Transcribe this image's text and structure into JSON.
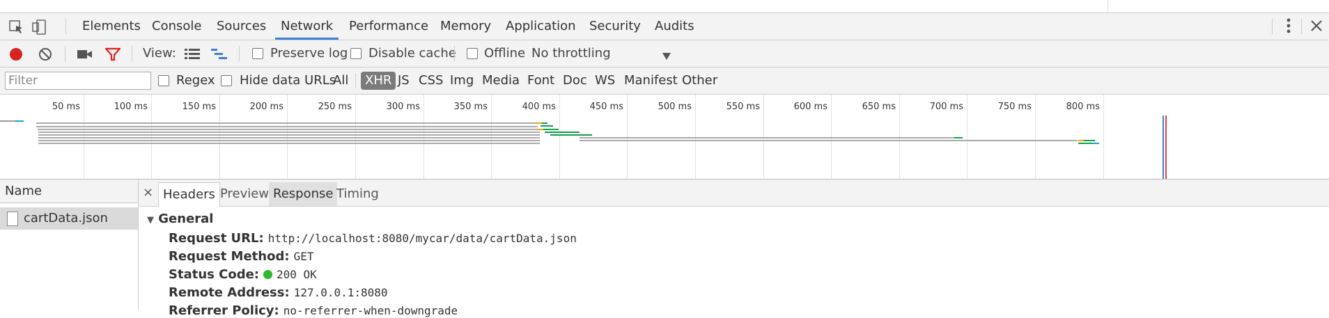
{
  "tabs": [
    "Elements",
    "Console",
    "Sources",
    "Network",
    "Performance",
    "Memory",
    "Application",
    "Security",
    "Audits"
  ],
  "active_tab": "Network",
  "toolbar": {
    "view_label": "View:",
    "preserve_log": "Preserve log",
    "disable_cache": "Disable cache",
    "offline": "Offline",
    "throttling": "No throttling"
  },
  "filter": {
    "placeholder": "Filter",
    "regex": "Regex",
    "hide_data_urls": "Hide data URLs",
    "types": [
      "All",
      "XHR",
      "JS",
      "CSS",
      "Img",
      "Media",
      "Font",
      "Doc",
      "WS",
      "Manifest",
      "Other"
    ],
    "active_type": "XHR"
  },
  "timeline": {
    "ticks": [
      "50 ms",
      "100 ms",
      "150 ms",
      "200 ms",
      "250 ms",
      "300 ms",
      "350 ms",
      "400 ms",
      "450 ms",
      "500 ms",
      "550 ms",
      "600 ms",
      "650 ms",
      "700 ms",
      "750 ms",
      "800 ms"
    ]
  },
  "requests": {
    "header": "Name",
    "items": [
      "cartData.json"
    ]
  },
  "detail": {
    "close": "×",
    "tabs": [
      "Headers",
      "Preview",
      "Response",
      "Timing"
    ],
    "active_tab": "Headers",
    "section": "General",
    "fields": [
      {
        "key": "Request URL:",
        "value": "http://localhost:8080/mycar/data/cartData.json"
      },
      {
        "key": "Request Method:",
        "value": "GET"
      },
      {
        "key": "Status Code:",
        "value": "200 OK"
      },
      {
        "key": "Remote Address:",
        "value": "127.0.0.1:8080"
      },
      {
        "key": "Referrer Policy:",
        "value": "no-referrer-when-downgrade"
      }
    ]
  },
  "colors": {
    "accent": "#3f7fd6",
    "record": "#d92121",
    "filter_icon": "#e0211f",
    "status_ok": "#2eb82e"
  }
}
